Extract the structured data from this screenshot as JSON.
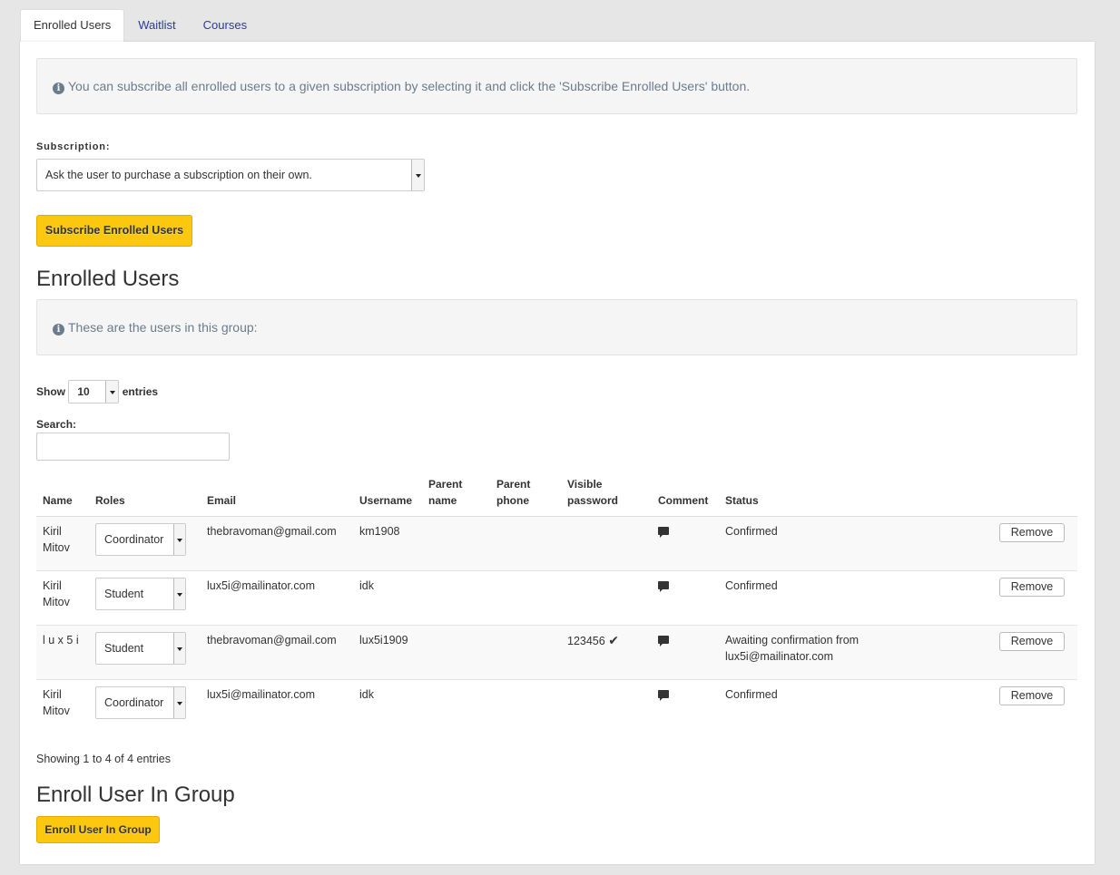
{
  "tabs": [
    {
      "label": "Enrolled Users",
      "active": true
    },
    {
      "label": "Waitlist",
      "active": false
    },
    {
      "label": "Courses",
      "active": false
    }
  ],
  "info1": "You can subscribe all enrolled users to a given subscription by selecting it and click the 'Subscribe Enrolled Users' button.",
  "subscription": {
    "label": "Subscription:",
    "selected": "Ask the user to purchase a subscription on their own."
  },
  "subscribe_button": "Subscribe Enrolled Users",
  "enrolled_heading": "Enrolled Users",
  "info2": "These are the users in this group:",
  "entries": {
    "show": "Show",
    "value": "10",
    "suffix": "entries"
  },
  "search_label": "Search:",
  "table": {
    "headers": {
      "name": "Name",
      "roles": "Roles",
      "email": "Email",
      "username": "Username",
      "parent_name": "Parent name",
      "parent_phone": "Parent phone",
      "visible_password": "Visible password",
      "comment": "Comment",
      "status": "Status"
    },
    "rows": [
      {
        "name": "Kiril Mitov",
        "role": "Coordinator",
        "email": "thebravoman@gmail.com",
        "username": "km1908",
        "parent_name": "",
        "parent_phone": "",
        "password": "",
        "status": "Confirmed",
        "action": "Remove"
      },
      {
        "name": "Kiril Mitov",
        "role": "Student",
        "email": "lux5i@mailinator.com",
        "username": "idk",
        "parent_name": "",
        "parent_phone": "",
        "password": "",
        "status": "Confirmed",
        "action": "Remove"
      },
      {
        "name": "l u x 5 i",
        "role": "Student",
        "email": "thebravoman@gmail.com",
        "username": "lux5i1909",
        "parent_name": "",
        "parent_phone": "",
        "password": "123456",
        "status": "Awaiting confirmation from lux5i@mailinator.com",
        "action": "Remove"
      },
      {
        "name": "Kiril Mitov",
        "role": "Coordinator",
        "email": "lux5i@mailinator.com",
        "username": "idk",
        "parent_name": "",
        "parent_phone": "",
        "password": "",
        "status": "Confirmed",
        "action": "Remove"
      }
    ]
  },
  "showing": "Showing 1 to 4 of 4 entries",
  "enroll_heading": "Enroll User In Group",
  "enroll_button": "Enroll User In Group",
  "colors": {
    "accent": "#fbc70f",
    "link": "#2b3a9b"
  }
}
